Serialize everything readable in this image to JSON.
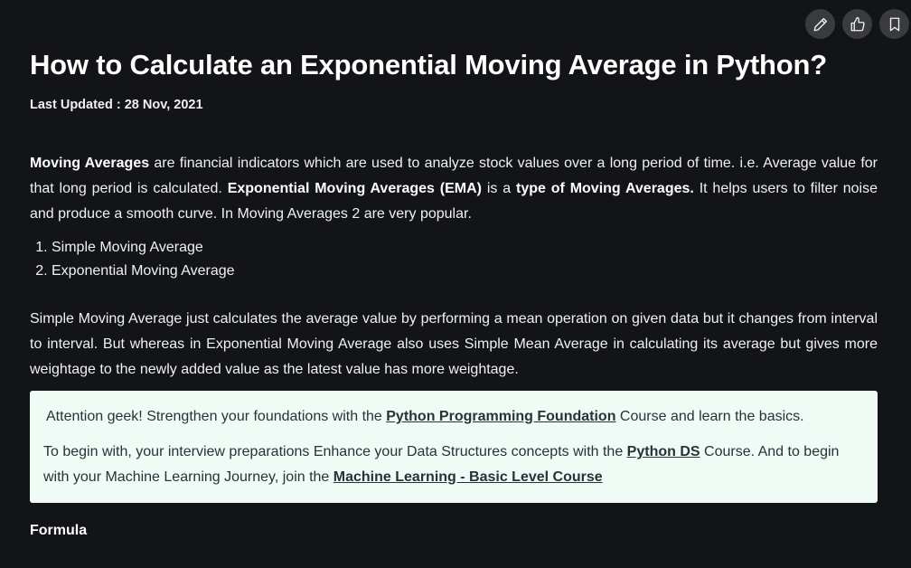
{
  "actions": {
    "edit_icon": "pencil-icon",
    "like_icon": "thumbs-up-icon",
    "bookmark_icon": "bookmark-icon"
  },
  "article": {
    "title": "How to Calculate an Exponential Moving Average in Python?",
    "last_updated": "Last Updated : 28 Nov, 2021",
    "intro": {
      "term1": "Moving Averages",
      "text1": " are financial indicators which are used to analyze stock values over a long period of time. i.e. Average value for that long period is calculated. ",
      "term2": "Exponential Moving Averages (EMA)",
      "text2": " is a ",
      "term3": "type of Moving Averages.",
      "text3": " It helps users to filter noise and produce a smooth curve. In Moving Averages 2 are very popular."
    },
    "list": [
      "Simple Moving Average",
      "Exponential Moving Average"
    ],
    "paragraph2": "Simple Moving Average just calculates the average value by performing a mean operation on given data but it changes from interval to interval. But whereas in Exponential Moving Average also uses Simple Mean Average in calculating its average but gives more weightage to the newly added value as the latest value has more weightage.",
    "callout": {
      "line1_pre": "Attention geek! Strengthen your foundations with the ",
      "line1_link": "Python Programming Foundation",
      "line1_post": " Course and learn the basics.",
      "line2_pre": "To begin with, your interview preparations Enhance your Data Structures concepts with the ",
      "line2_link1": "Python DS",
      "line2_mid": " Course. And to begin with your Machine Learning Journey, join the ",
      "line2_link2": "Machine Learning - Basic Level Course"
    },
    "formula_heading": "Formula"
  },
  "colors": {
    "background": "#131417",
    "callout_bg": "#f0fbf6",
    "callout_text": "#273239",
    "action_btn_bg": "#3a3b3f"
  }
}
